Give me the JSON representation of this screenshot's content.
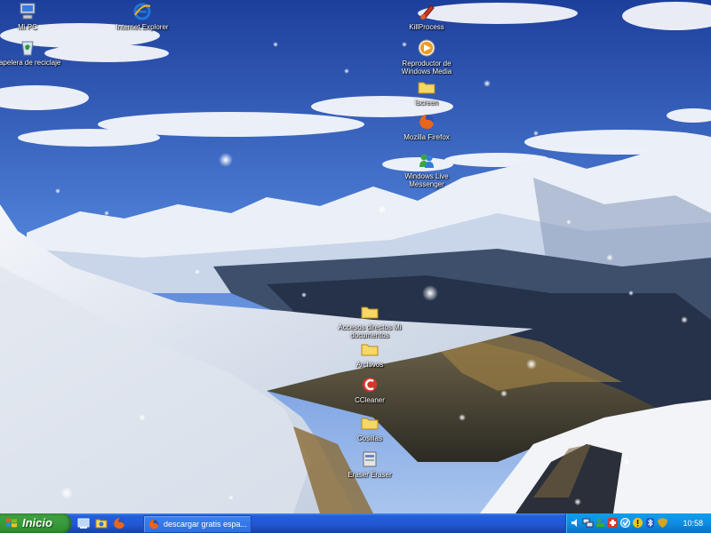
{
  "desktop": {
    "icons": [
      {
        "name": "mi-pc-icon",
        "label": "Mi PC",
        "glyph": "computer"
      },
      {
        "name": "papelera-icon",
        "label": "Papelera de reciclaje",
        "glyph": "recycle-bin"
      },
      {
        "name": "internet-explorer-icon",
        "label": "Internet Explorer",
        "glyph": "internet-explorer"
      },
      {
        "name": "killprocess-icon",
        "label": "KillProcess",
        "glyph": "killprocess"
      },
      {
        "name": "reproductor-windows-media-icon",
        "label": "Reproductor de Windows Media",
        "glyph": "media-player"
      },
      {
        "name": "lscreen-folder-icon",
        "label": "lscreen",
        "glyph": "folder"
      },
      {
        "name": "mozilla-firefox-icon",
        "label": "Mozilla Firefox",
        "glyph": "firefox"
      },
      {
        "name": "windows-live-messenger-icon",
        "label": "Windows Live Messenger",
        "glyph": "messenger"
      },
      {
        "name": "accesos-directos-folder-icon",
        "label": "Accesos directos Mi documentos",
        "glyph": "folder"
      },
      {
        "name": "archivos-folder-icon",
        "label": "Archivos",
        "glyph": "folder"
      },
      {
        "name": "ccleaner-icon",
        "label": "CCleaner",
        "glyph": "ccleaner"
      },
      {
        "name": "cosillas-folder-icon",
        "label": "Cosillas",
        "glyph": "folder"
      },
      {
        "name": "eraser-icon",
        "label": "Eraser Eraser",
        "glyph": "eraser"
      }
    ]
  },
  "taskbar": {
    "start_label": "Inicio",
    "quick_launch": [
      "show-desktop-icon",
      "windows-explorer-icon",
      "firefox-quick-icon"
    ],
    "task_button_label": "descargar gratis espa...",
    "tray_icons": [
      "speaker-icon",
      "network-icon",
      "messenger-tray-icon",
      "antivirus-icon",
      "warning-icon",
      "update-icon",
      "bluetooth-icon",
      "shield-tray-icon"
    ],
    "clock": "10:58"
  },
  "colors": {
    "taskbar_blue": "#245edb",
    "start_green": "#3c9f3c",
    "tray_blue": "#0f8de0"
  }
}
